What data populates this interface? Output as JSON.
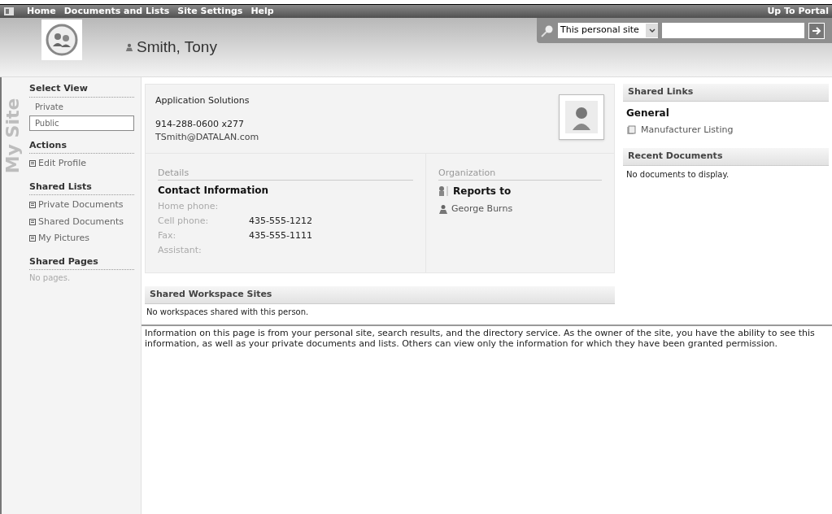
{
  "top_nav": {
    "items": [
      "Home",
      "Documents and Lists",
      "Site Settings",
      "Help"
    ],
    "portal_link": "Up To Portal"
  },
  "header": {
    "title": "Smith, Tony",
    "search": {
      "scope": "This personal site"
    }
  },
  "sidebar": {
    "watermark": "My Site",
    "sections": [
      {
        "title": "Select View",
        "kind": "views",
        "items": [
          {
            "label": "Private",
            "selected": false
          },
          {
            "label": "Public",
            "selected": true
          }
        ]
      },
      {
        "title": "Actions",
        "kind": "links",
        "items": [
          {
            "label": "Edit Profile"
          }
        ]
      },
      {
        "title": "Shared Lists",
        "kind": "links",
        "items": [
          {
            "label": "Private Documents"
          },
          {
            "label": "Shared Documents"
          },
          {
            "label": "My Pictures"
          }
        ]
      },
      {
        "title": "Shared Pages",
        "kind": "empty",
        "items": [
          {
            "label": "No pages."
          }
        ]
      }
    ]
  },
  "profile": {
    "department": "Application Solutions",
    "phone": "914-288-0600 x277",
    "email": "TSmith@DATALAN.com"
  },
  "details": {
    "heading": "Details",
    "subheading": "Contact Information",
    "fields": [
      {
        "label": "Home phone:"
      },
      {
        "label": "Cell phone:",
        "value": "435-555-1212"
      },
      {
        "label": "Fax:",
        "value": "435-555-1111"
      },
      {
        "label": "Assistant:"
      }
    ]
  },
  "organization": {
    "heading": "Organization",
    "subheading": "Reports to",
    "manager": "George Burns"
  },
  "workspaces": {
    "title": "Shared Workspace Sites",
    "message": "No workspaces shared with this person."
  },
  "shared_links": {
    "title": "Shared Links",
    "group": "General",
    "links": [
      "Manufacturer Listing"
    ]
  },
  "recent_documents": {
    "title": "Recent Documents",
    "message": "No documents to display."
  },
  "footer_note": "Information on this page is from your personal site, search results, and the directory service. As the owner of the site, you have the ability to see this information, as well as your private documents and lists. Others can view only the information for which they have been granted permission."
}
